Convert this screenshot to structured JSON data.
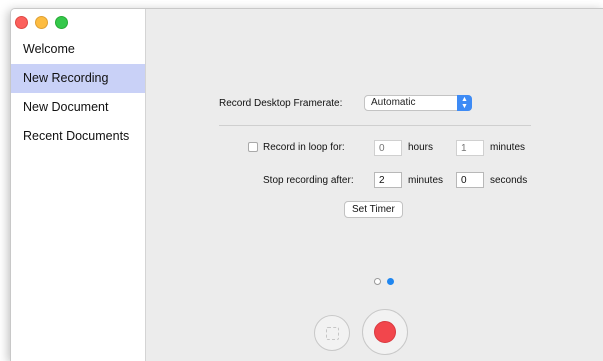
{
  "sidebar": {
    "items": [
      {
        "label": "Welcome"
      },
      {
        "label": "New Recording"
      },
      {
        "label": "New Document"
      },
      {
        "label": "Recent Documents"
      }
    ],
    "selected_index": 1
  },
  "framerate": {
    "label": "Record Desktop Framerate:",
    "value": "Automatic"
  },
  "loop": {
    "label": "Record in loop for:",
    "checked": false,
    "hours_placeholder": "0",
    "hours_label": "hours",
    "minutes_placeholder": "1",
    "minutes_label": "minutes"
  },
  "stop_after": {
    "label": "Stop recording after:",
    "minutes_value": "2",
    "minutes_label": "minutes",
    "seconds_value": "0",
    "seconds_label": "seconds"
  },
  "set_timer_label": "Set Timer",
  "page_indicator": {
    "count": 2,
    "current": 2
  },
  "colors": {
    "selection": "#c9d1f7",
    "accent": "#1f86f0",
    "record": "#f2464c"
  }
}
